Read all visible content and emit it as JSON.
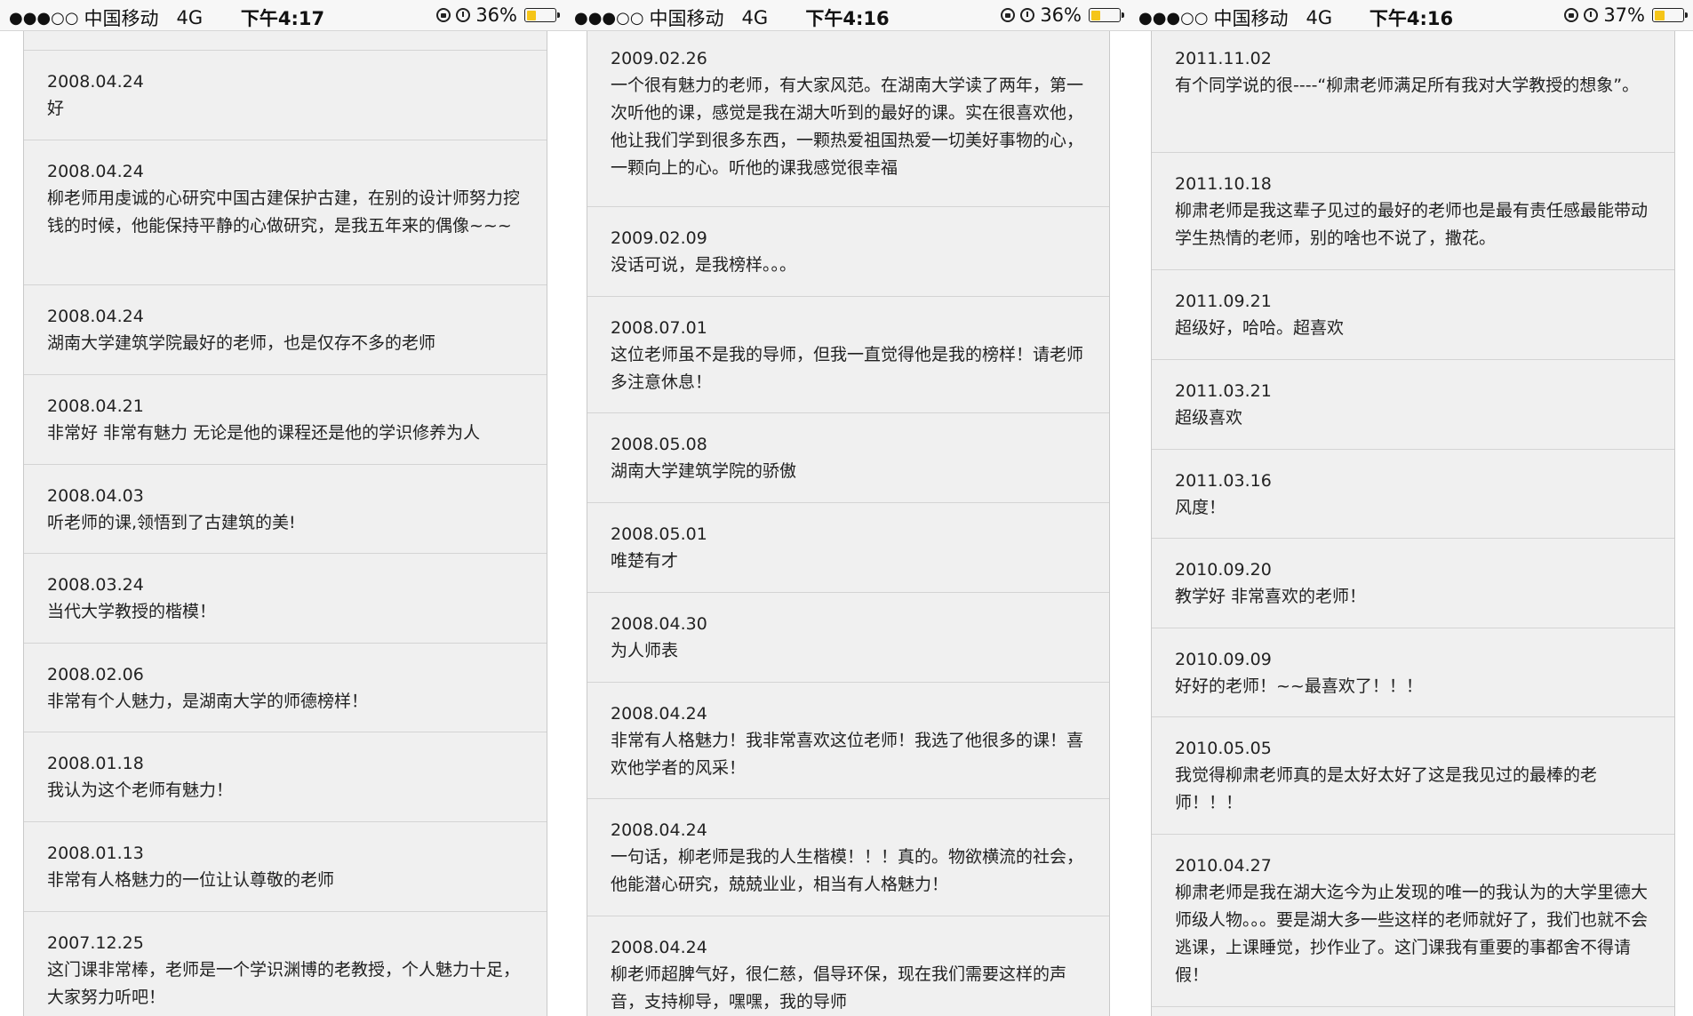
{
  "panels": [
    {
      "status": {
        "signal": "●●●○○",
        "carrier": "中国移动",
        "network": "4G",
        "time": "下午4:17",
        "battery_pct": "36%",
        "battery_level": 0.36
      },
      "entries": [
        {
          "date": "2008.04.24",
          "text": "好"
        },
        {
          "date": "2008.04.24",
          "text": "柳老师用虔诚的心研究中国古建保护古建，在别的设计师努力挖钱的时候，他能保持平静的心做研究，是我五年来的偶像~~~"
        },
        {
          "date": "2008.04.24",
          "text": "湖南大学建筑学院最好的老师，也是仅存不多的老师"
        },
        {
          "date": "2008.04.21",
          "text": "非常好 非常有魅力 无论是他的课程还是他的学识修养为人"
        },
        {
          "date": "2008.04.03",
          "text": "听老师的课,领悟到了古建筑的美!"
        },
        {
          "date": "2008.03.24",
          "text": "当代大学教授的楷模！"
        },
        {
          "date": "2008.02.06",
          "text": "非常有个人魅力，是湖南大学的师德榜样！"
        },
        {
          "date": "2008.01.18",
          "text": "我认为这个老师有魅力！"
        },
        {
          "date": "2008.01.13",
          "text": "非常有人格魅力的一位让认尊敬的老师"
        },
        {
          "date": "2007.12.25",
          "text": "这门课非常棒，老师是一个学识渊博的老教授，个人魅力十足，大家努力听吧！"
        }
      ]
    },
    {
      "status": {
        "signal": "●●●○○",
        "carrier": "中国移动",
        "network": "4G",
        "time": "下午4:16",
        "battery_pct": "36%",
        "battery_level": 0.36
      },
      "entries": [
        {
          "date": "2009.02.26",
          "text": "一个很有魅力的老师，有大家风范。在湖南大学读了两年，第一次听他的课，感觉是我在湖大听到的最好的课。实在很喜欢他，他让我们学到很多东西，一颗热爱祖国热爱一切美好事物的心，一颗向上的心。听他的课我感觉很幸福"
        },
        {
          "date": "2009.02.09",
          "text": "没话可说，是我榜样。。。"
        },
        {
          "date": "2008.07.01",
          "text": "这位老师虽不是我的导师，但我一直觉得他是我的榜样！请老师多注意休息！"
        },
        {
          "date": "2008.05.08",
          "text": "湖南大学建筑学院的骄傲"
        },
        {
          "date": "2008.05.01",
          "text": "唯楚有才"
        },
        {
          "date": "2008.04.30",
          "text": "为人师表"
        },
        {
          "date": "2008.04.24",
          "text": "非常有人格魅力！我非常喜欢这位老师！我选了他很多的课！喜欢他学者的风采！"
        },
        {
          "date": "2008.04.24",
          "text": "一句话，柳老师是我的人生楷模！！！真的。物欲横流的社会，他能潜心研究，兢兢业业，相当有人格魅力！"
        },
        {
          "date": "2008.04.24",
          "text": "柳老师超脾气好，很仁慈，倡导环保，现在我们需要这样的声音，支持柳导，嘿嘿，我的导师"
        }
      ]
    },
    {
      "status": {
        "signal": "●●●○○",
        "carrier": "中国移动",
        "network": "4G",
        "time": "下午4:16",
        "battery_pct": "37%",
        "battery_level": 0.37
      },
      "entries": [
        {
          "date": "2011.11.02",
          "text": "有个同学说的很----“柳肃老师满足所有我对大学教授的想象”。"
        },
        {
          "date": "2011.10.18",
          "text": "柳肃老师是我这辈子见过的最好的老师也是最有责任感最能带动学生热情的老师，别的啥也不说了，撒花。"
        },
        {
          "date": "2011.09.21",
          "text": "超级好，哈哈。超喜欢"
        },
        {
          "date": "2011.03.21",
          "text": "超级喜欢"
        },
        {
          "date": "2011.03.16",
          "text": "风度！"
        },
        {
          "date": "2010.09.20",
          "text": "教学好 非常喜欢的老师！"
        },
        {
          "date": "2010.09.09",
          "text": "好好的老师！~~最喜欢了！！！"
        },
        {
          "date": "2010.05.05",
          "text": "我觉得柳肃老师真的是太好太好了这是我见过的最棒的老师！！！"
        },
        {
          "date": "2010.04.27",
          "text": "柳肃老师是我在湖大迄今为止发现的唯一的我认为的大学里德大师级人物。。。要是湖大多一些这样的老师就好了，我们也就不会逃课，上课睡觉，抄作业了。这门课我有重要的事都舍不得请假！"
        }
      ]
    }
  ]
}
